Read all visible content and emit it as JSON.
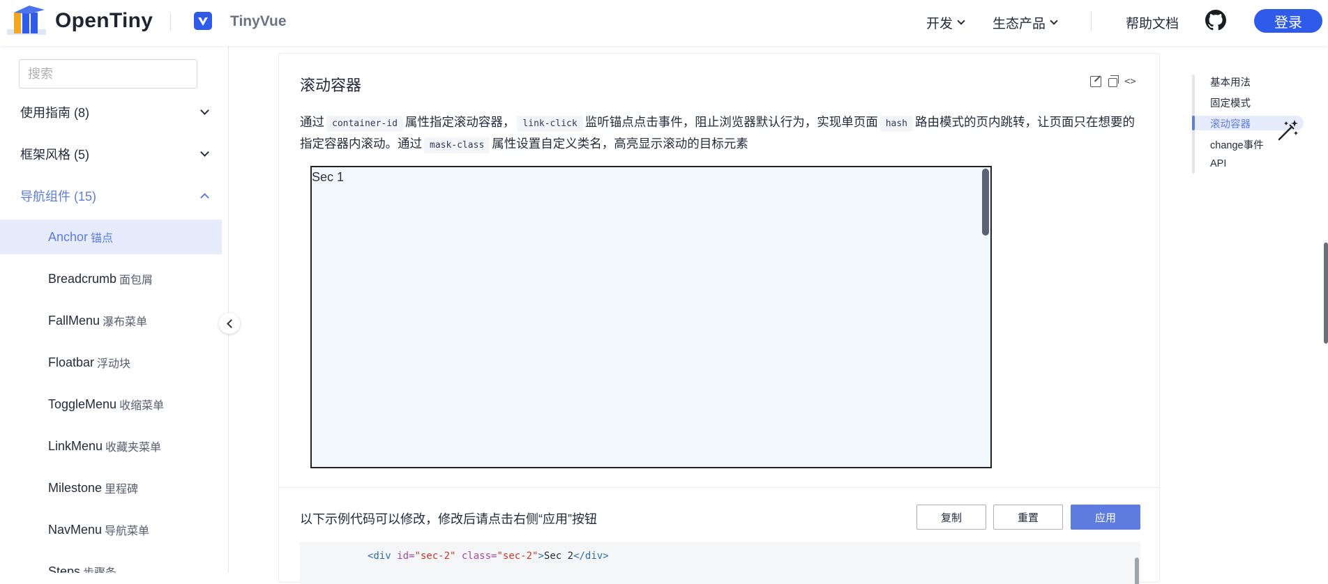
{
  "header": {
    "brand": "OpenTiny",
    "product": "TinyVue",
    "nav": [
      {
        "label": "开发"
      },
      {
        "label": "生态产品"
      }
    ],
    "help": "帮助文档",
    "login": "登录"
  },
  "sidebar": {
    "search_placeholder": "搜索",
    "groups": [
      {
        "label": "使用指南 (8)"
      },
      {
        "label": "框架风格 (5)"
      },
      {
        "label": "导航组件 (15)"
      }
    ],
    "items": [
      {
        "en": "Anchor",
        "cn": "锚点"
      },
      {
        "en": "Breadcrumb",
        "cn": "面包屑"
      },
      {
        "en": "FallMenu",
        "cn": "瀑布菜单"
      },
      {
        "en": "Floatbar",
        "cn": "浮动块"
      },
      {
        "en": "ToggleMenu",
        "cn": "收缩菜单"
      },
      {
        "en": "LinkMenu",
        "cn": "收藏夹菜单"
      },
      {
        "en": "Milestone",
        "cn": "里程碑"
      },
      {
        "en": "NavMenu",
        "cn": "导航菜单"
      },
      {
        "en": "Steps",
        "cn": "步骤条"
      }
    ]
  },
  "demo": {
    "title": "滚动容器",
    "desc": {
      "p1": "通过",
      "c1": "container-id",
      "p2": "属性指定滚动容器，",
      "c2": "link-click",
      "p3": "监听锚点点击事件，阻止浏览器默认行为，实现单页面",
      "c3": "hash",
      "p4": "路由模式的页内跳转，让页面只在想要的指定容器内滚动。通过",
      "c4": "mask-class",
      "p5": "属性设置自定义类名，高亮显示滚动的目标元素"
    },
    "section_text": "Sec 1",
    "edit_tip": "以下示例代码可以修改，修改后请点击右侧“应用”按钮",
    "buttons": {
      "copy": "复制",
      "reset": "重置",
      "apply": "应用"
    },
    "code": {
      "open_tag": "<div",
      "id_attr": " id=",
      "id_val": "\"sec-2\"",
      "class_attr": " class=",
      "class_val": "\"sec-2\"",
      "gt": ">",
      "content": "Sec 2",
      "close_tag": "</div>"
    }
  },
  "toc": {
    "items": [
      "基本用法",
      "固定模式",
      "滚动容器",
      "change事件",
      "API"
    ],
    "active_index": 2
  },
  "colors": {
    "accent": "#5e7ce0",
    "brand_blue": "#2f5bea",
    "active_bg": "#e6ecfc"
  }
}
